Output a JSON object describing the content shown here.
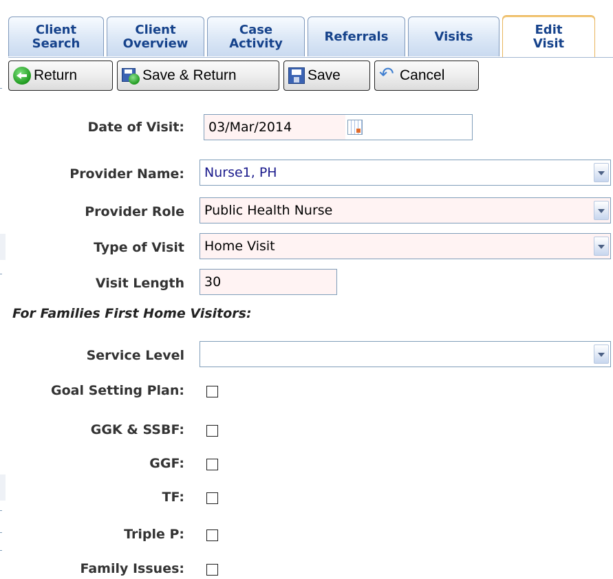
{
  "tabs": [
    {
      "label": "Client\nSearch",
      "active": false
    },
    {
      "label": "Client\nOverview",
      "active": false
    },
    {
      "label": "Case\nActivity",
      "active": false
    },
    {
      "label": "Referrals",
      "active": false
    },
    {
      "label": "Visits",
      "active": false
    },
    {
      "label": "Edit\nVisit",
      "active": true
    }
  ],
  "toolbar": {
    "return_label": "Return",
    "save_return_label": "Save & Return",
    "save_label": "Save",
    "cancel_label": "Cancel"
  },
  "form": {
    "date_label": "Date of Visit:",
    "date_value": "03/Mar/2014",
    "provider_name_label": "Provider Name:",
    "provider_name_value": "Nurse1, PH",
    "provider_role_label": "Provider Role",
    "provider_role_value": "Public Health Nurse",
    "visit_type_label": "Type of Visit",
    "visit_type_value": "Home Visit",
    "visit_length_label": "Visit Length",
    "visit_length_value": "30",
    "section_title": "For Families First Home Visitors:",
    "service_level_label": "Service Level",
    "service_level_value": "",
    "checkboxes": [
      {
        "label": "Goal Setting Plan:",
        "checked": false
      },
      {
        "label": "GGK & SSBF:",
        "checked": false
      },
      {
        "label": "GGF:",
        "checked": false
      },
      {
        "label": "TF:",
        "checked": false
      },
      {
        "label": "Triple P:",
        "checked": false
      },
      {
        "label": "Family Issues:",
        "checked": false
      }
    ]
  },
  "colors": {
    "tab_text": "#15428b",
    "provider_name_text": "#1a1a8c",
    "required_field_bg": "#fff3f3"
  },
  "icons": [
    "return-icon",
    "save-return-icon",
    "save-icon",
    "cancel-icon",
    "calendar-icon",
    "chevron-down-icon"
  ]
}
